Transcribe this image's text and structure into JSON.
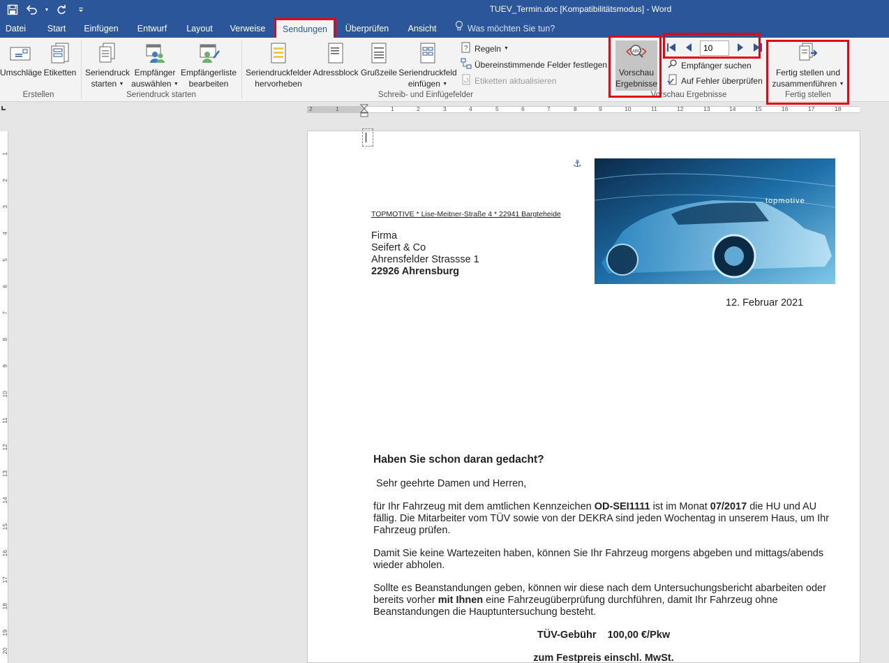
{
  "window": {
    "title": "TUEV_Termin.doc [Kompatibilitätsmodus]  -  Word"
  },
  "qat": {
    "icons": [
      "save-icon",
      "undo-icon",
      "redo-icon",
      "customize-icon"
    ]
  },
  "tabs": [
    "Datei",
    "Start",
    "Einfügen",
    "Entwurf",
    "Layout",
    "Verweise",
    "Sendungen",
    "Überprüfen",
    "Ansicht"
  ],
  "active_tab": "Sendungen",
  "tell_me": "Was möchten Sie tun?",
  "ribbon": {
    "erstellen": {
      "label": "Erstellen",
      "umschlaege": "Umschläge",
      "etiketten": "Etiketten"
    },
    "seriendruck_starten": {
      "label": "Seriendruck starten",
      "seriendruck_l1": "Seriendruck",
      "seriendruck_l2": "starten",
      "empfaenger_l1": "Empfänger",
      "empfaenger_l2": "auswählen",
      "liste_l1": "Empfängerliste",
      "liste_l2": "bearbeiten"
    },
    "schreib": {
      "label": "Schreib- und Einfügefelder",
      "hervorheben_l1": "Seriendruckfelder",
      "hervorheben_l2": "hervorheben",
      "adressblock": "Adressblock",
      "grusszeile": "Grußzeile",
      "feld_l1": "Seriendruckfeld",
      "feld_l2": "einfügen",
      "regeln": "Regeln",
      "uebereinstimmende": "Übereinstimmende Felder festlegen",
      "etiketten_aktualisieren": "Etiketten aktualisieren"
    },
    "vorschau": {
      "label": "Vorschau Ergebnisse",
      "vorschau_l1": "Vorschau",
      "vorschau_l2": "Ergebnisse",
      "record": "10",
      "empfaenger_suchen": "Empfänger suchen",
      "fehler": "Auf Fehler überprüfen"
    },
    "fertig": {
      "label": "Fertig stellen",
      "btn_l1": "Fertig stellen und",
      "btn_l2": "zusammenführen"
    }
  },
  "ruler": {
    "h_ticks": [
      "2",
      "1",
      "1",
      "2",
      "3",
      "4",
      "5",
      "6",
      "7",
      "8",
      "9",
      "10",
      "11",
      "12",
      "13",
      "14",
      "15",
      "16",
      "17",
      "18"
    ],
    "v_ticks": [
      "1",
      "2",
      "3",
      "4",
      "5",
      "6",
      "7",
      "8",
      "9",
      "10",
      "11",
      "12",
      "13",
      "14",
      "15",
      "16",
      "17",
      "18",
      "19",
      "20"
    ]
  },
  "document": {
    "sender": "TOPMOTIVE * Lise-Meitner-Straße 4 * 22941 Bargteheide",
    "logo_text": "topmotive",
    "address": [
      "Firma",
      "Seifert & Co",
      "Ahrensfelder Strassse 1"
    ],
    "address_city": "22926 Ahrensburg",
    "date": "12. Februar 2021",
    "heading": "Haben Sie schon daran gedacht?",
    "salutation": " Sehr geehrte Damen und Herren,",
    "p1_a": "für Ihr Fahrzeug mit dem amtlichen Kennzeichen ",
    "p1_plate": "OD-SEI1111",
    "p1_b": " ist im Monat ",
    "p1_month": "07/2017",
    "p1_c": " die HU und AU fällig. Die Mitarbeiter vom TÜV sowie von der DEKRA sind jeden Wochentag in unserem Haus, um Ihr Fahrzeug prüfen.",
    "p2": "Damit Sie keine Wartezeiten haben, können Sie Ihr Fahrzeug morgens abgeben und mittags/abends wieder abholen.",
    "p3_a": "Sollte es Beanstandungen geben, können wir diese nach dem Untersuchungsbericht abarbeiten oder bereits vorher ",
    "p3_bold": "mit Ihnen",
    "p3_b": " eine Fahrzeugüberprüfung durchführen, damit Ihr Fahrzeug ohne Beanstandungen die Hauptuntersuchung besteht.",
    "fee": "TÜV-Gebühr    100,00 €/Pkw",
    "fixed": "zum Festpreis einschl. MwSt."
  }
}
